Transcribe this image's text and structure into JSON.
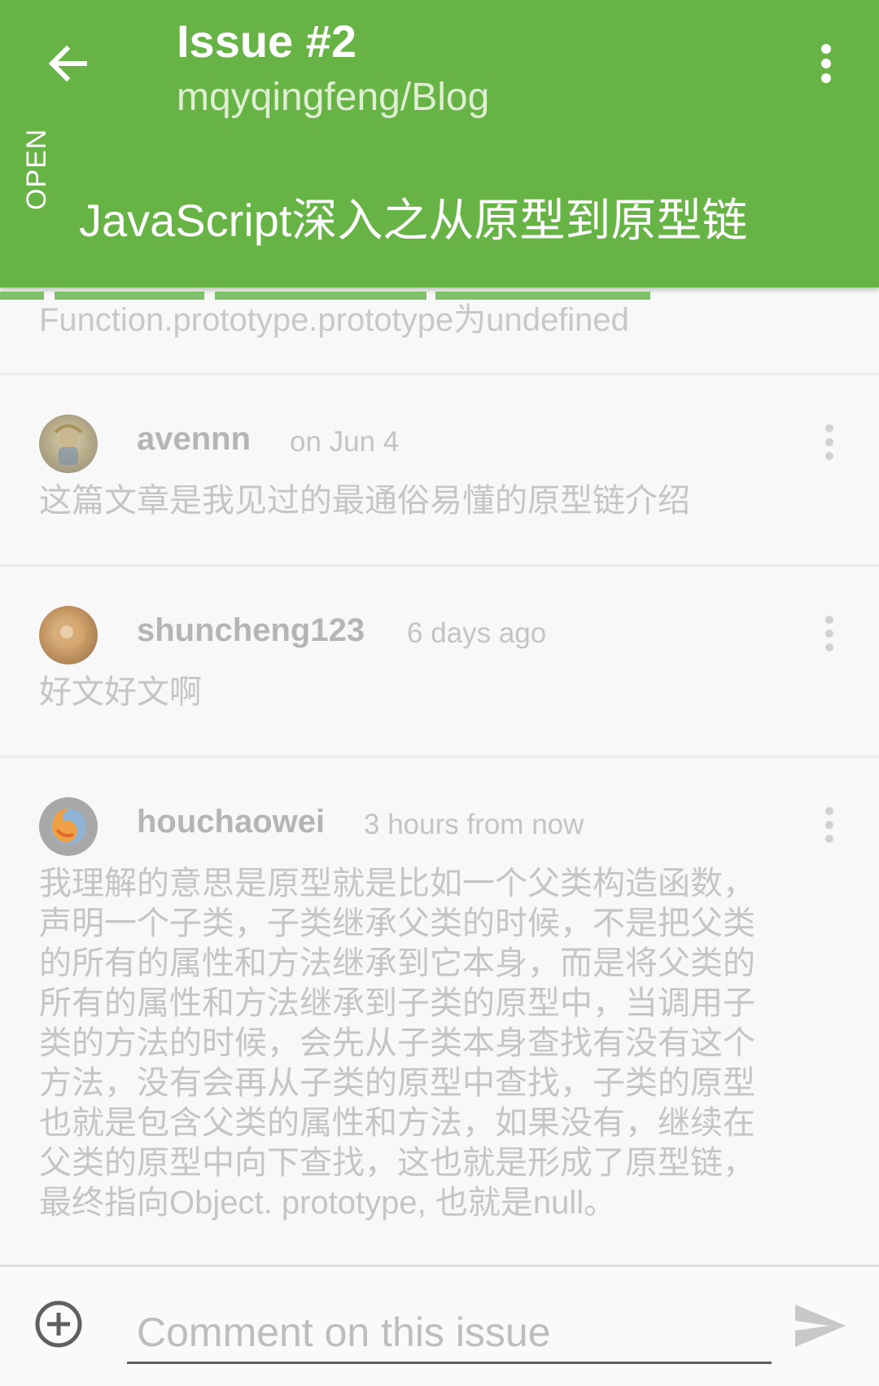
{
  "header": {
    "title": "Issue #2",
    "repo": "mqyqingfeng/Blog",
    "state": "OPEN",
    "subject": "JavaScript深入之从原型到原型链",
    "back_icon": "arrow-left-icon",
    "menu_icon": "more-vertical-icon",
    "accent": "#67b346"
  },
  "partial": {
    "text": "Function.prototype.prototype为undefined"
  },
  "comments": [
    {
      "author": "avennn",
      "time": "on Jun 4",
      "body": "这篇文章是我见过的最通俗易懂的原型链介绍"
    },
    {
      "author": "shuncheng123",
      "time": "6 days ago",
      "body": "好文好文啊"
    },
    {
      "author": "houchaowei",
      "time": "3 hours from now",
      "body": "我理解的意思是原型就是比如一个父类构造函数，\n声明一个子类，子类继承父类的时候，不是把父类\n的所有的属性和方法继承到它本身，而是将父类的\n所有的属性和方法继承到子类的原型中，当调用子\n类的方法的时候，会先从子类本身查找有没有这个\n方法，没有会再从子类的原型中查找，子类的原型\n也就是包含父类的属性和方法，如果没有，继续在\n父类的原型中向下查找，这也就是形成了原型链，\n最终指向Object. prototype, 也就是null。"
    }
  ],
  "input": {
    "placeholder": "Comment on this issue",
    "add_icon": "plus-circle-icon",
    "send_icon": "send-icon"
  }
}
